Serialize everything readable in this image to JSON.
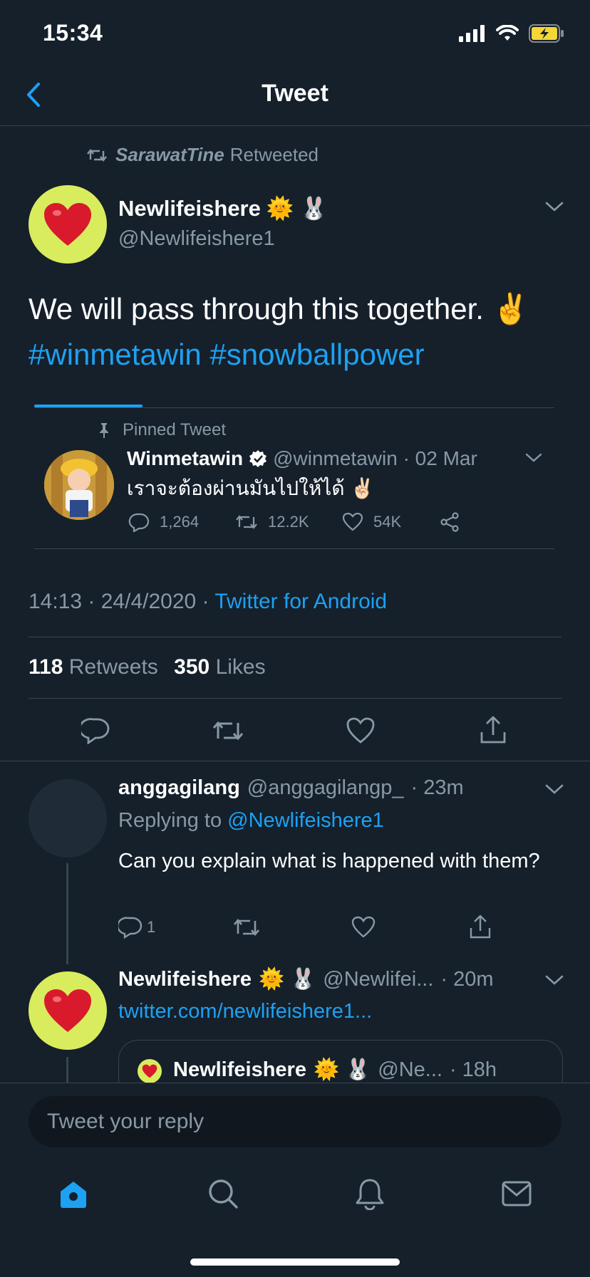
{
  "status_bar": {
    "time": "15:34"
  },
  "nav": {
    "title": "Tweet"
  },
  "retweet_context": {
    "user": "SarawatTine",
    "label": "Retweeted"
  },
  "tweet": {
    "author_name": "Newlifeishere",
    "author_emoji": "🌞 🐰",
    "author_handle": "@Newlifeishere1",
    "text": "We will pass through this together. ✌️",
    "hashtags": "#winmetawin #snowballpower",
    "time": "14:13 · 24/4/2020 ·",
    "source": "Twitter for Android",
    "retweet_count": "118",
    "retweet_label": "Retweets",
    "like_count": "350",
    "like_label": "Likes"
  },
  "pinned_card": {
    "pinned_label": "Pinned Tweet",
    "name": "Winmetawin",
    "handle_time": "@winmetawin · 02 Mar",
    "text": "เราจะต้องผ่านมันไปให้ได้ ✌🏻",
    "replies": "1,264",
    "retweets": "12.2K",
    "likes": "54K"
  },
  "replies": [
    {
      "name": "anggagilang",
      "handle": "@anggagilangp_",
      "time": "· 23m",
      "replying_prefix": "Replying to",
      "replying_to": "@Newlifeishere1",
      "text": "Can you explain what is happened with them?",
      "reply_count": "1"
    },
    {
      "name": "Newlifeishere",
      "emoji": "🌞 🐰",
      "handle": "@Newlifei...",
      "time": "· 20m",
      "link": "twitter.com/newlifeishere1...",
      "quoted_name": "Newlifeishere",
      "quoted_emoji": "🌞 🐰",
      "quoted_handle": "@Ne...",
      "quoted_time": "· 18h"
    }
  ],
  "compose": {
    "placeholder": "Tweet your reply"
  },
  "colors": {
    "background": "#15202b",
    "accent": "#1da1f2",
    "muted": "#8899a6",
    "divider": "#38444d"
  }
}
